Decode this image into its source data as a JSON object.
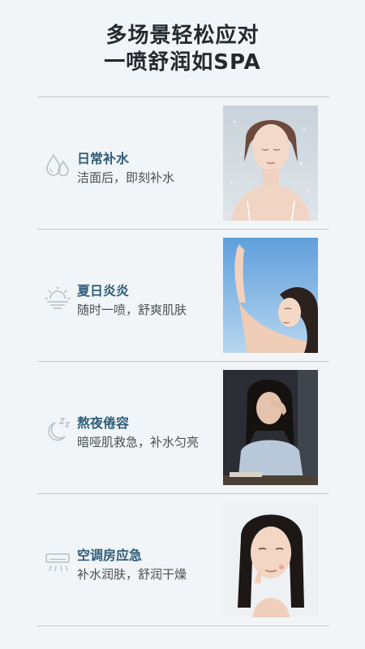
{
  "header": {
    "line1": "多场景轻松应对",
    "line2": "一喷舒润如SPA"
  },
  "scenes": [
    {
      "icon": "water-drops-icon",
      "title": "日常补水",
      "subtitle": "洁面后，即刻补水"
    },
    {
      "icon": "sunrise-icon",
      "title": "夏日炎炎",
      "subtitle": "随时一喷，舒爽肌肤"
    },
    {
      "icon": "moon-zz-icon",
      "title": "熬夜倦容",
      "subtitle": "暗哑肌救急，补水匀亮"
    },
    {
      "icon": "air-conditioner-icon",
      "title": "空调房应急",
      "subtitle": "补水润肤，舒润干燥"
    }
  ],
  "colors": {
    "background": "#f1f5f8",
    "title_accent": "#2f5c78",
    "icon_gray": "#b8bfc6",
    "divider": "#c3c9cf"
  }
}
